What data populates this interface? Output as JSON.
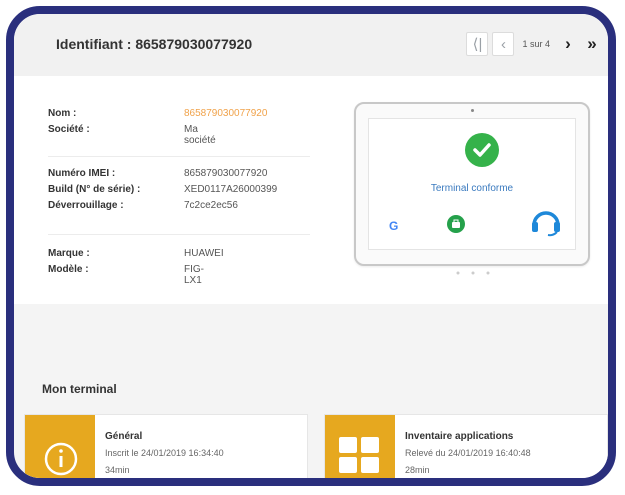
{
  "header": {
    "title": "Identifiant : 865879030077920",
    "page_count": "1 sur 4"
  },
  "device": {
    "rows_group1": [
      {
        "label": "Nom :",
        "value": "865879030077920"
      },
      {
        "label": "Société :",
        "value": "Ma société"
      }
    ],
    "rows_group2": [
      {
        "label": "Numéro IMEI :",
        "value": "865879030077920"
      },
      {
        "label": "Build (N° de série) :",
        "value": "XED0117A26000399"
      },
      {
        "label": "Déverrouillage :",
        "value": "7c2ce2ec56"
      }
    ],
    "rows_group3": [
      {
        "label": "Marque :",
        "value": "HUAWEI"
      },
      {
        "label": "Modèle :",
        "value": "FIG-LX1"
      }
    ]
  },
  "tablet": {
    "status_text": "Terminal conforme",
    "google_letter": "G"
  },
  "section": {
    "title": "Mon terminal"
  },
  "tiles": [
    {
      "title": "Général",
      "line1": "Inscrit le 24/01/2019 16:34:40",
      "line2": "34min",
      "icon": "info-icon"
    },
    {
      "title": "Inventaire applications",
      "line1": "Relevé du 24/01/2019 16:40:48",
      "line2": "28min",
      "icon": "grid-apps-icon"
    }
  ],
  "colors": {
    "accent": "#e6a81f",
    "frame": "#2a2f7d",
    "highlight": "#f0a24a",
    "success": "#35b24a",
    "link": "#3a7abf"
  }
}
